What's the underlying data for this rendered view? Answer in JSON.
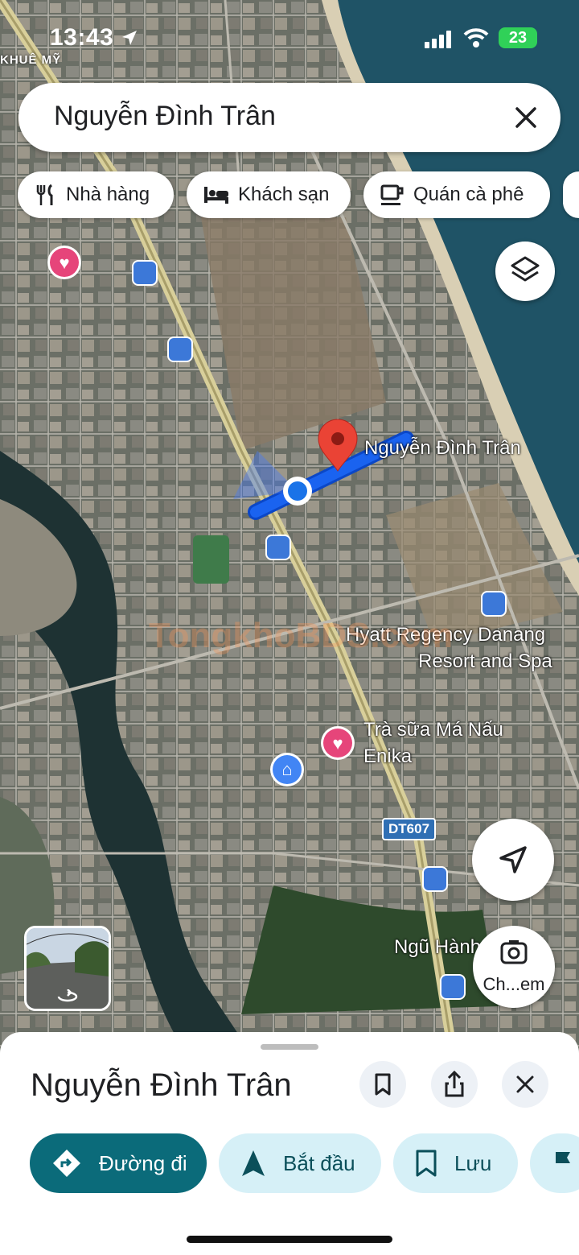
{
  "status_bar": {
    "time": "13:43",
    "battery": "23"
  },
  "map": {
    "corner_label": "KHUÊ MỸ",
    "place_label": "Nguyễn Đình Trân",
    "hotel_line1": "Hyatt Regency Danang",
    "hotel_line2": "Resort and Spa",
    "cafe_line1": "Trà sữa Má Nấu",
    "cafe_line2": "Enika",
    "area_label": "Ngũ Hành",
    "road_badge": "DT607",
    "watermark": "TongkhoBDS.com"
  },
  "search": {
    "query": "Nguyễn Đình Trân"
  },
  "chips": [
    {
      "label": "Nhà hàng",
      "icon": "restaurant-icon"
    },
    {
      "label": "Khách sạn",
      "icon": "hotel-icon"
    },
    {
      "label": "Quán cà phê",
      "icon": "coffee-icon"
    }
  ],
  "camera_button": {
    "label": "Ch...em"
  },
  "sheet": {
    "title": "Nguyễn Đình Trân",
    "actions": [
      {
        "label": "Đường đi",
        "icon": "directions-icon"
      },
      {
        "label": "Bắt đầu",
        "icon": "navigation-arrow-icon"
      },
      {
        "label": "Lưu",
        "icon": "bookmark-icon"
      }
    ]
  },
  "colors": {
    "accent": "#0b6b7a",
    "route": "#1a5fe8",
    "pin": "#ea4335",
    "chip_bg": "#d6f0f7"
  }
}
